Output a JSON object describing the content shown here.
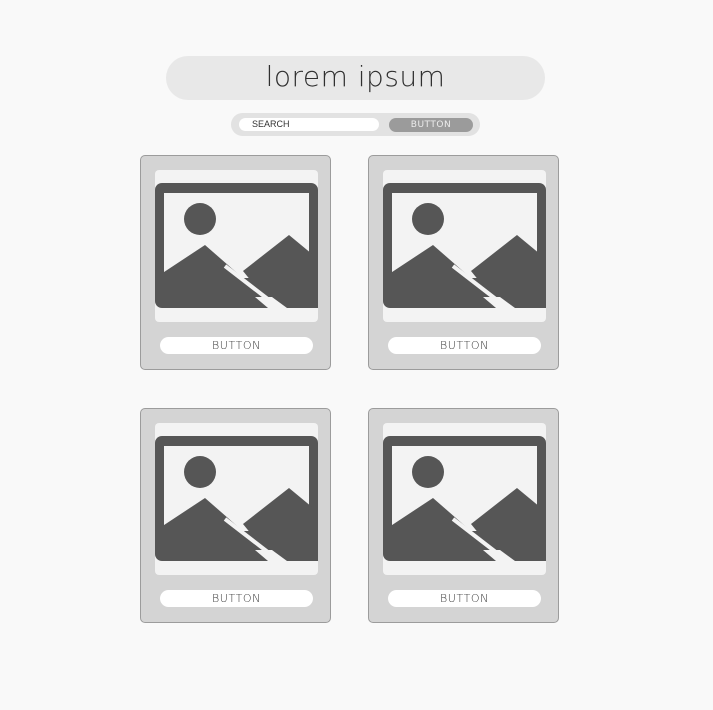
{
  "header": {
    "title": "lorem ipsum"
  },
  "search": {
    "placeholder": "SEARCH",
    "button_label": "BUTTON"
  },
  "cards": [
    {
      "image_icon": "image-placeholder-icon",
      "button_label": "BUTTON"
    },
    {
      "image_icon": "image-placeholder-icon",
      "button_label": "BUTTON"
    },
    {
      "image_icon": "image-placeholder-icon",
      "button_label": "BUTTON"
    },
    {
      "image_icon": "image-placeholder-icon",
      "button_label": "BUTTON"
    }
  ],
  "colors": {
    "background": "#f9f9f9",
    "card": "#d4d4d4",
    "icon": "#565656",
    "search_button": "#9b9b9b"
  }
}
